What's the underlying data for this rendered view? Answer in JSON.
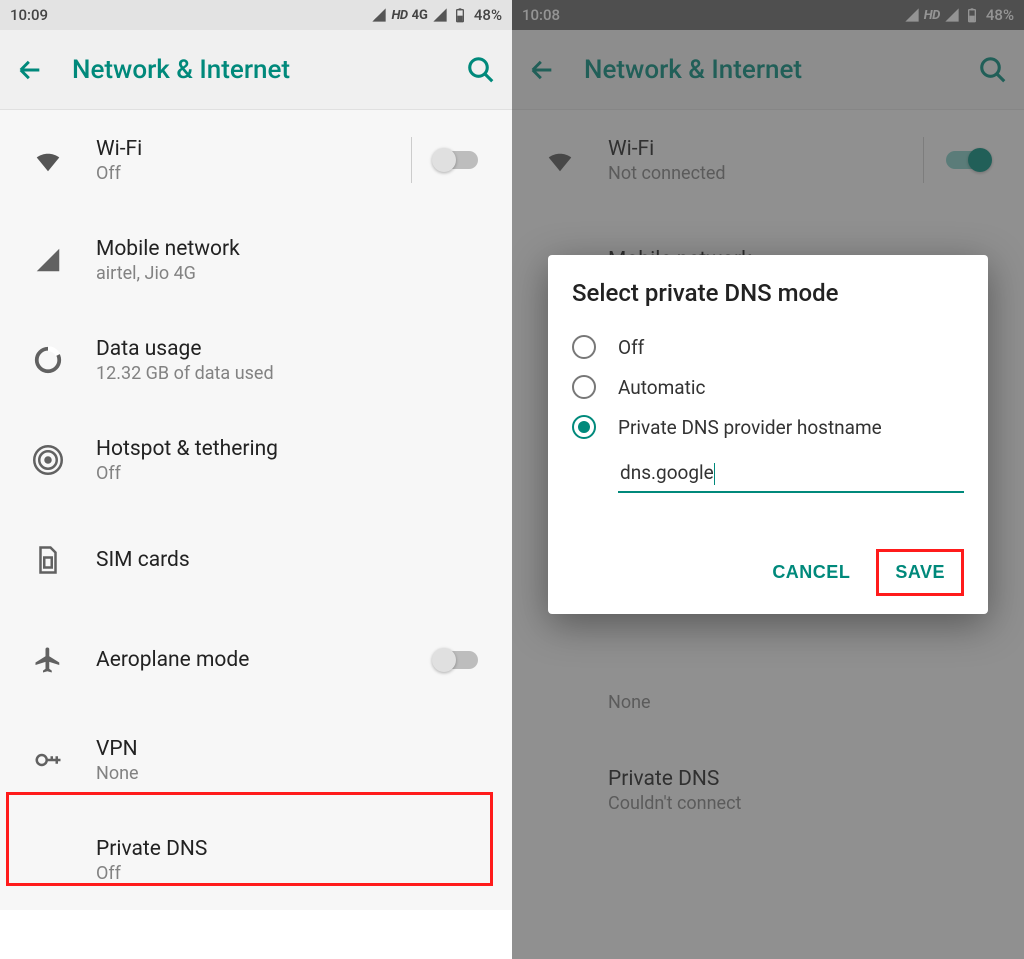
{
  "left": {
    "status": {
      "time": "10:09",
      "hd": "HD",
      "net": "4G",
      "battery": "48%"
    },
    "appbar": {
      "title": "Network & Internet"
    },
    "items": {
      "wifi": {
        "title": "Wi-Fi",
        "sub": "Off"
      },
      "mobile": {
        "title": "Mobile network",
        "sub": "airtel, Jio 4G"
      },
      "data": {
        "title": "Data usage",
        "sub": "12.32 GB of data used"
      },
      "hotspot": {
        "title": "Hotspot & tethering",
        "sub": "Off"
      },
      "sim": {
        "title": "SIM cards"
      },
      "plane": {
        "title": "Aeroplane mode"
      },
      "vpn": {
        "title": "VPN",
        "sub": "None"
      },
      "pdns": {
        "title": "Private DNS",
        "sub": "Off"
      }
    }
  },
  "right": {
    "status": {
      "time": "10:08",
      "hd": "HD",
      "battery": "48%"
    },
    "appbar": {
      "title": "Network & Internet"
    },
    "items": {
      "wifi": {
        "title": "Wi-Fi",
        "sub": "Not connected"
      },
      "mobile": {
        "title": "Mobile network"
      },
      "vpn": {
        "sub": "None"
      },
      "pdns": {
        "title": "Private DNS",
        "sub": "Couldn't connect"
      }
    },
    "dialog": {
      "title": "Select private DNS mode",
      "opt_off": "Off",
      "opt_auto": "Automatic",
      "opt_host": "Private DNS provider hostname",
      "hostname": "dns.google",
      "cancel": "CANCEL",
      "save": "SAVE"
    }
  }
}
